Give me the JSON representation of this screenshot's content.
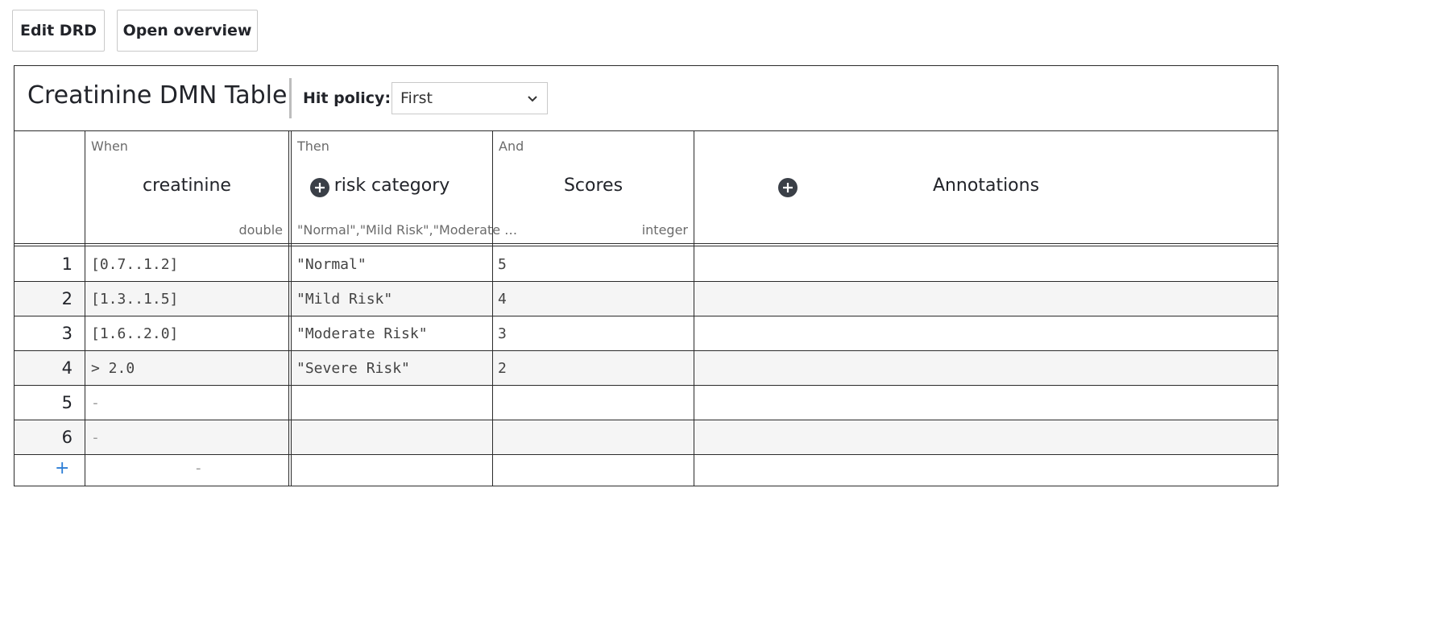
{
  "toolbar": {
    "edit_drd_label": "Edit DRD",
    "open_overview_label": "Open overview"
  },
  "table": {
    "name": "Creatinine DMN Table",
    "hit_policy_label": "Hit policy:",
    "hit_policy_value": "First"
  },
  "columns": {
    "input": {
      "clause": "When",
      "name": "creatinine",
      "type": "double"
    },
    "output1": {
      "clause": "Then",
      "name": "risk category",
      "type": "\"Normal\",\"Mild Risk\",\"Moderate Risk\",\"Severe Risk\""
    },
    "output2": {
      "clause": "And",
      "name": "Scores",
      "type": "integer"
    },
    "annotations": {
      "name": "Annotations"
    }
  },
  "rows": [
    {
      "num": "1",
      "input": "[0.7..1.2]",
      "risk": "\"Normal\"",
      "score": "5",
      "annotation": ""
    },
    {
      "num": "2",
      "input": "[1.3..1.5]",
      "risk": "\"Mild Risk\"",
      "score": "4",
      "annotation": ""
    },
    {
      "num": "3",
      "input": "[1.6..2.0]",
      "risk": "\"Moderate Risk\"",
      "score": "3",
      "annotation": ""
    },
    {
      "num": "4",
      "input": "> 2.0",
      "risk": "\"Severe Risk\"",
      "score": "2",
      "annotation": ""
    },
    {
      "num": "5",
      "input": "-",
      "risk": "",
      "score": "",
      "annotation": ""
    },
    {
      "num": "6",
      "input": "-",
      "risk": "",
      "score": "",
      "annotation": ""
    }
  ],
  "add_row": {
    "plus": "+",
    "dash": "-"
  },
  "icons": {
    "add_column": "plus-circle-icon",
    "dropdown": "chevron-down-icon"
  },
  "colors": {
    "border": "#2b2b2b",
    "alt_row": "#f5f5f5",
    "add_row_plus": "#2d7ed6",
    "add_column_button": "#3a3f47"
  }
}
